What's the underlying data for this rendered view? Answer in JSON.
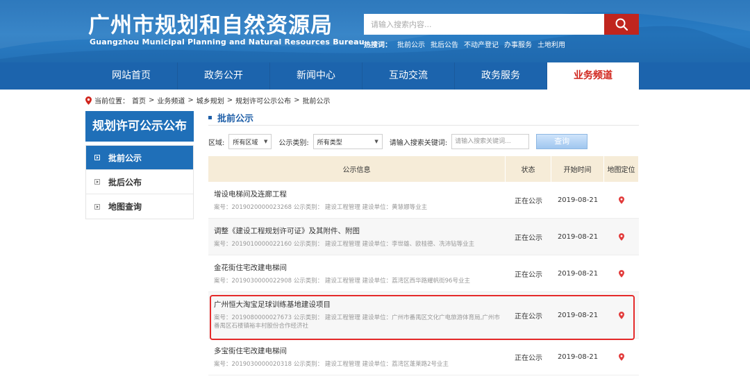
{
  "header": {
    "title": "广州市规划和自然资源局",
    "subtitle": "Guangzhou Municipal Planning and Natural Resources Bureau",
    "search_placeholder": "请输入搜索内容...",
    "hotwords_label": "热搜词：",
    "hotwords": [
      "批前公示",
      "批后公告",
      "不动产登记",
      "办事服务",
      "土地利用"
    ]
  },
  "nav": {
    "items": [
      "网站首页",
      "政务公开",
      "新闻中心",
      "互动交流",
      "政务服务",
      "业务频道"
    ],
    "active_index": 5
  },
  "breadcrumb": {
    "label": "当前位置：",
    "items": [
      "首页",
      "业务频道",
      "城乡规划",
      "规划许可公示公布",
      "批前公示"
    ],
    "separator": ">"
  },
  "sidebar": {
    "title": "规划许可公示公布",
    "items": [
      "批前公示",
      "批后公布",
      "地图查询"
    ],
    "active_index": 0
  },
  "main": {
    "section_title": "批前公示",
    "filters": {
      "region_label": "区域:",
      "region_value": "所有区域",
      "type_label": "公示类别:",
      "type_value": "所有类型",
      "keyword_label": "请输入搜索关键词:",
      "keyword_placeholder": "请输入搜索关键词...",
      "query_button": "查询"
    },
    "table": {
      "headers": [
        "公示信息",
        "状态",
        "开始时间",
        "地图定位"
      ],
      "rows": [
        {
          "title": "增设电梯间及连廊工程",
          "detail": "案号：2019020000023268 公示类别： 建设工程管理 建设单位：黄慧娜等业主",
          "status": "正在公示",
          "date": "2019-08-21"
        },
        {
          "title": "调整《建设工程规划许可证》及其附件、附图",
          "detail": "案号：2019010000022160 公示类别： 建设工程管理 建设单位：李世雄、欧桂德、冼沛钻等业主",
          "status": "正在公示",
          "date": "2019-08-21"
        },
        {
          "title": "金花街住宅改建电梯间",
          "detail": "案号：2019030000022908 公示类别： 建设工程管理 建设单位：荔湾区西华路耀帆街96号业主",
          "status": "正在公示",
          "date": "2019-08-21"
        },
        {
          "title": "广州恒大淘宝足球训练基地建设项目",
          "detail": "案号：2019080000027673 公示类别： 建设工程管理 建设单位：广州市番禺区文化广电旅游体育局,广州市番禺区石楼镇裕丰村股份合作经济社",
          "status": "正在公示",
          "date": "2019-08-21"
        },
        {
          "title": "多宝街住宅改建电梯间",
          "detail": "案号：2019030000020318 公示类别： 建设工程管理 建设单位：荔湾区蓬莱路2号业主",
          "status": "正在公示",
          "date": "2019-08-21"
        }
      ]
    }
  },
  "colors": {
    "header_blue": "#2a7dc4",
    "nav_blue": "#1c64ad",
    "accent_red": "#d0241c",
    "highlight_red": "#e52a2a",
    "table_header_bg": "#f6ecd8"
  }
}
